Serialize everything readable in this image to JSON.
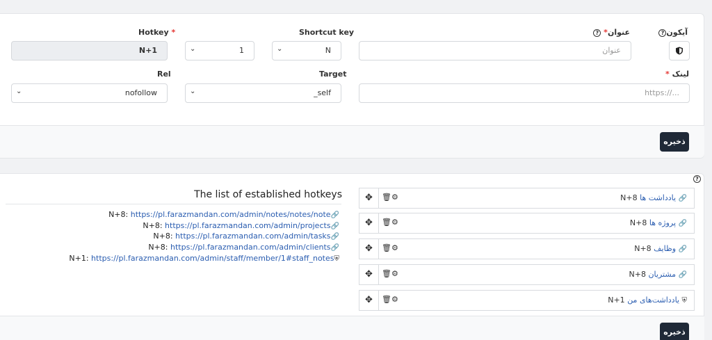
{
  "form": {
    "icon_label": "آیکون",
    "title_label": "عنوان",
    "title_placeholder": "عنوان",
    "shortcut_label": "Shortcut key",
    "shortcut_value": "N",
    "shortcut_num": "1",
    "hotkey_label": "Hotkey",
    "hotkey_value": "N+1",
    "link_label": "لینک",
    "link_placeholder": "https://...",
    "target_label": "Target",
    "target_value": "_self",
    "rel_label": "Rel",
    "rel_value": "nofollow",
    "save_label": "ذخیره"
  },
  "hotkeys": {
    "title": "The list of established hotkeys",
    "items": [
      {
        "key": "N+8:",
        "url": "https://pl.farazmandan.com/admin/notes/notes/note",
        "icon": "link-icon"
      },
      {
        "key": "N+8:",
        "url": "https://pl.farazmandan.com/admin/projects",
        "icon": "link-icon"
      },
      {
        "key": "N+8:",
        "url": "https://pl.farazmandan.com/admin/tasks",
        "icon": "link-icon"
      },
      {
        "key": "N+8:",
        "url": "https://pl.farazmandan.com/admin/clients",
        "icon": "link-icon"
      },
      {
        "key": "N+1:",
        "url": "https://pl.farazmandan.com/admin/staff/member/1#staff_notes",
        "icon": "shield-icon"
      }
    ]
  },
  "menu_items": [
    {
      "label": "یادداشت ها",
      "hotkey": "N+8",
      "icon": "link-icon"
    },
    {
      "label": "پروژه ها",
      "hotkey": "N+8",
      "icon": "link-icon"
    },
    {
      "label": "وظایف",
      "hotkey": "N+8",
      "icon": "link-icon"
    },
    {
      "label": "مشتریان",
      "hotkey": "N+8",
      "icon": "link-icon"
    },
    {
      "label": "یادداشت‌های من",
      "hotkey": "N+1",
      "icon": "shield-icon"
    }
  ],
  "save_label_bottom": "ذخیره"
}
